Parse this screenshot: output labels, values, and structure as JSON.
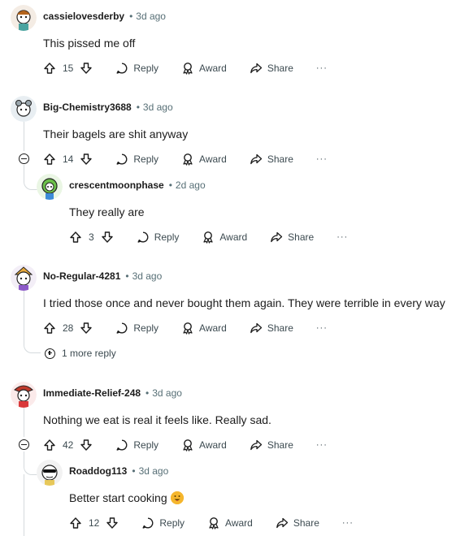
{
  "actions": {
    "reply": "Reply",
    "award": "Award",
    "share": "Share",
    "more": "···"
  },
  "comments": [
    {
      "author": "cassielovesderby",
      "time": "3d ago",
      "text": "This pissed me off",
      "votes": "15"
    },
    {
      "author": "Big-Chemistry3688",
      "time": "3d ago",
      "text": "Their bagels are shit anyway",
      "votes": "14"
    },
    {
      "author": "crescentmoonphase",
      "time": "2d ago",
      "text": "They really are",
      "votes": "3"
    },
    {
      "author": "No-Regular-4281",
      "time": "3d ago",
      "text": "I tried those once and never bought them again. They were terrible in every way",
      "votes": "28"
    },
    {
      "author": "Immediate-Relief-248",
      "time": "3d ago",
      "text": "Nothing we eat is real it feels like. Really sad.",
      "votes": "42"
    },
    {
      "author": "Roaddog113",
      "time": "3d ago",
      "text": "Better start cooking",
      "votes": "12"
    }
  ],
  "more_replies": "1 more reply",
  "separator": "•",
  "icons": [
    "upvote-icon",
    "downvote-icon",
    "reply-icon",
    "award-icon",
    "share-icon",
    "more-options-icon",
    "collapse-icon",
    "expand-icon",
    "emoji-icon"
  ]
}
